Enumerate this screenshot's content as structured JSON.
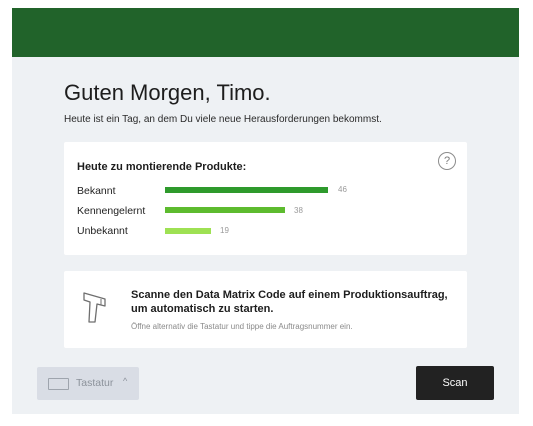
{
  "header": {
    "brand_color": "#21632a"
  },
  "greeting": {
    "title": "Guten Morgen, Timo.",
    "subtitle": "Heute ist ein Tag, an dem Du viele neue Herausforderungen bekommst."
  },
  "stats": {
    "title": "Heute zu montierende Produkte:",
    "help_icon": "?",
    "rows": [
      {
        "label": "Bekannt",
        "value": "46",
        "color": "#2e9a2c"
      },
      {
        "label": "Kennengelernt",
        "value": "38",
        "color": "#5dbb2f"
      },
      {
        "label": "Unbekannt",
        "value": "19",
        "color": "#9ee153"
      }
    ]
  },
  "scan_card": {
    "icon": "barcode-scanner-icon",
    "title": "Scanne den Data Matrix Code auf einem Produktionsauftrag, um automatisch zu starten.",
    "hint": "Öffne alternativ die Tastatur und tippe die Auftragsnummer ein."
  },
  "footer": {
    "keyboard_label": "Tastatur",
    "keyboard_chevron": "^",
    "scan_button": "Scan"
  }
}
